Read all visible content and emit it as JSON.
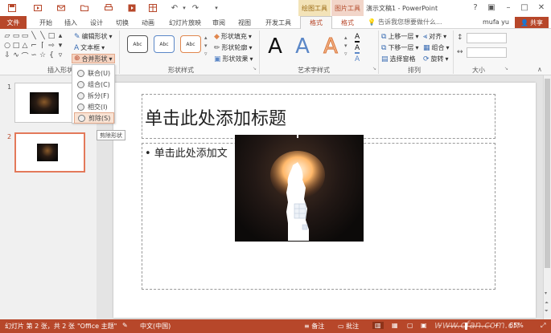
{
  "titlebar": {
    "qat_icons": [
      "save-icon",
      "play-icon",
      "undo-icon",
      "redo-icon",
      "customize-icon"
    ],
    "context_drawing": "绘图工具",
    "context_picture": "图片工具",
    "doc_title": "演示文稿1 - PowerPoint",
    "window_buttons": [
      "?",
      "▢",
      "–",
      "□",
      "✕"
    ]
  },
  "tabs": [
    "文件",
    "开始",
    "插入",
    "设计",
    "切换",
    "动画",
    "幻灯片放映",
    "审阅",
    "视图",
    "开发工具",
    "格式",
    "格式"
  ],
  "tellme": "告诉我您想要做什么...",
  "user": "mufa yu",
  "share": "共享",
  "ribbon": {
    "insert_shapes": {
      "label": "插入形状",
      "edit_shape": "编辑形状",
      "textbox": "文本框",
      "merge_shapes": "合并形状"
    },
    "shape_styles": {
      "label": "形状样式",
      "swatches": [
        "Abc",
        "Abc",
        "Abc"
      ],
      "fill": "形状填充",
      "outline": "形状轮廓",
      "effects": "形状效果"
    },
    "wordart": {
      "label": "艺术字样式",
      "letters": [
        "A",
        "A",
        "A"
      ]
    },
    "arrange": {
      "label": "排列",
      "bring_forward": "上移一层",
      "send_backward": "下移一层",
      "selection_pane": "选择窗格",
      "align": "对齐",
      "group": "组合",
      "rotate": "旋转"
    },
    "size": {
      "label": "大小"
    }
  },
  "merge_menu": {
    "items": [
      "联合(U)",
      "组合(C)",
      "拆分(F)",
      "相交(I)",
      "剪除(S)"
    ],
    "tooltip": "剪除形状"
  },
  "thumbnails": [
    {
      "num": "1"
    },
    {
      "num": "2"
    }
  ],
  "slide": {
    "title": "单击此处添加标题",
    "body": "• 单击此处添加文"
  },
  "statusbar": {
    "slide_info": "幻灯片 第 2 张，共 2 张",
    "theme": "\"Office 主题\"",
    "language": "中文(中国)",
    "notes": "备注",
    "comments": "批注",
    "zoom": "65%",
    "watermark": "www.cfan.com.cn"
  },
  "colors": {
    "accent": "#b7472a",
    "ribbon": "#f7f7f7",
    "canvas": "#e4e4e4"
  }
}
